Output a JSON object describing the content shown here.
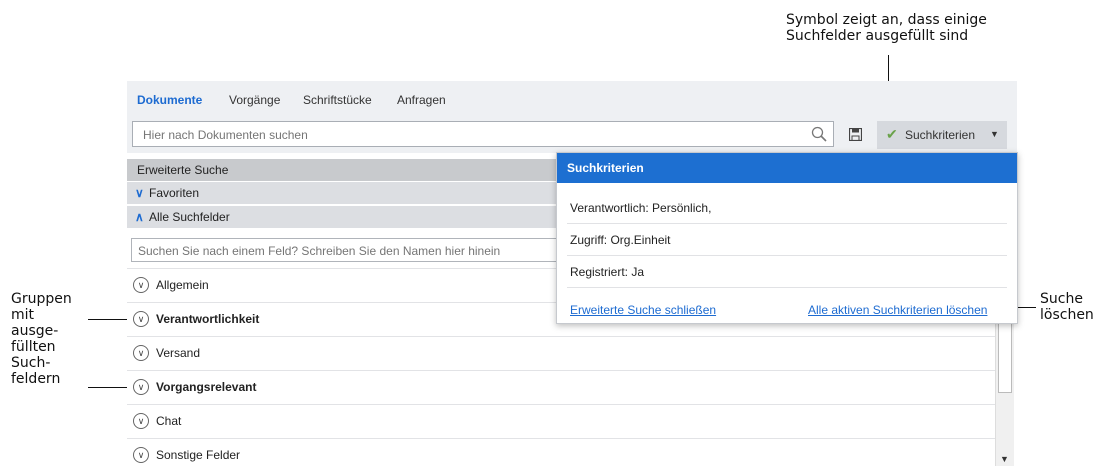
{
  "annotations": {
    "top": [
      "Symbol zeigt an, dass einige",
      "Suchfelder ausgefüllt sind"
    ],
    "left": [
      "Gruppen",
      "mit",
      "ausge-",
      "füllten",
      "Such-",
      "feldern"
    ],
    "right": [
      "Suche",
      "löschen"
    ]
  },
  "tabs": [
    "Dokumente",
    "Vorgänge",
    "Schriftstücke",
    "Anfragen"
  ],
  "search": {
    "placeholder": "Hier nach Dokumenten suchen"
  },
  "criteria_button": {
    "label": "Suchkriterien"
  },
  "sections": {
    "advanced": "Erweiterte Suche",
    "favorites": "Favoriten",
    "all_fields": "Alle Suchfelder"
  },
  "field_search": {
    "placeholder": "Suchen Sie nach einem Feld? Schreiben Sie den Namen hier hinein"
  },
  "groups": [
    {
      "label": "Allgemein",
      "filled": false
    },
    {
      "label": "Verantwortlichkeit",
      "filled": true
    },
    {
      "label": "Versand",
      "filled": false
    },
    {
      "label": "Vorgangsrelevant",
      "filled": true
    },
    {
      "label": "Chat",
      "filled": false
    },
    {
      "label": "Sonstige Felder",
      "filled": false
    }
  ],
  "popup": {
    "title": "Suchkriterien",
    "rows": [
      "Verantwortlich: Persönlich,",
      "Zugriff: Org.Einheit",
      "Registriert: Ja"
    ],
    "close_link": "Erweiterte Suche schließen",
    "clear_link": "Alle aktiven Suchkriterien löschen"
  },
  "colors": {
    "accent": "#1d6fd1",
    "check": "#6aa24a"
  },
  "icons": [
    "search-icon",
    "save-icon",
    "check-icon",
    "dropdown-arrow-icon",
    "chevron-down-icon",
    "chevron-up-icon",
    "expand-circle-icon"
  ]
}
